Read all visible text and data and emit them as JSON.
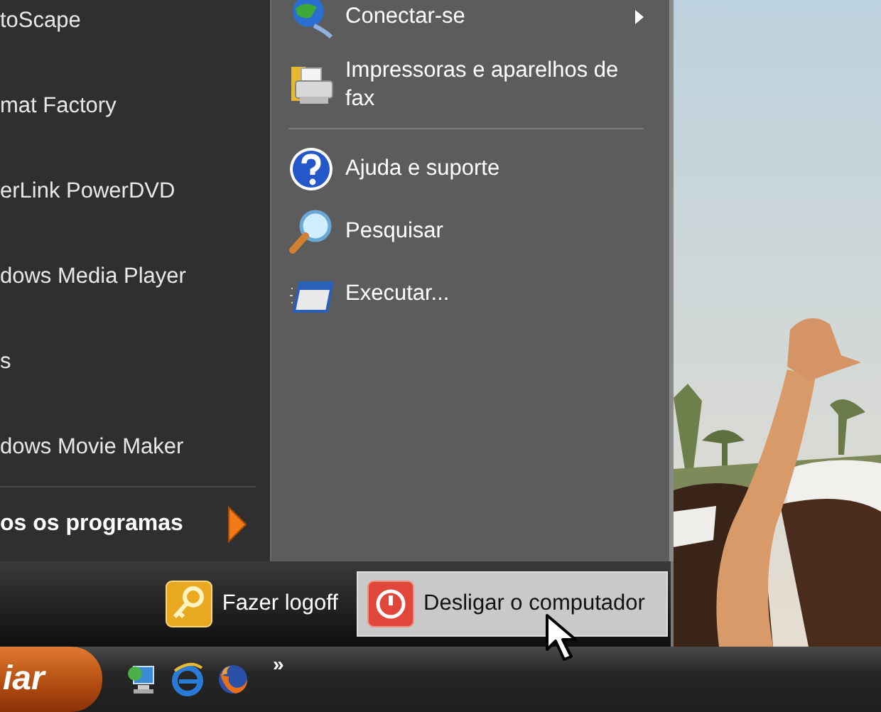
{
  "start_menu": {
    "programs": [
      {
        "label": "toScape"
      },
      {
        "label": "mat Factory"
      },
      {
        "label": "erLink PowerDVD"
      },
      {
        "label": "dows Media Player"
      },
      {
        "label": "s"
      },
      {
        "label": "dows Movie Maker"
      }
    ],
    "all_programs": {
      "label": "os os programas"
    },
    "places": [
      {
        "label": "Conectar-se",
        "submenu": true,
        "separator_after": false
      },
      {
        "label": "Impressoras e aparelhos de fax",
        "submenu": false,
        "separator_after": true
      },
      {
        "label": "Ajuda e suporte",
        "submenu": false,
        "separator_after": false
      },
      {
        "label": "Pesquisar",
        "submenu": false,
        "separator_after": false
      },
      {
        "label": "Executar...",
        "submenu": false,
        "separator_after": false
      }
    ],
    "logoff": {
      "label": "Fazer logoff",
      "selected": false
    },
    "shutdown": {
      "label": "Desligar o computador",
      "selected": true
    }
  },
  "taskbar": {
    "start_button": {
      "label": "iar"
    },
    "overflow": "»"
  }
}
